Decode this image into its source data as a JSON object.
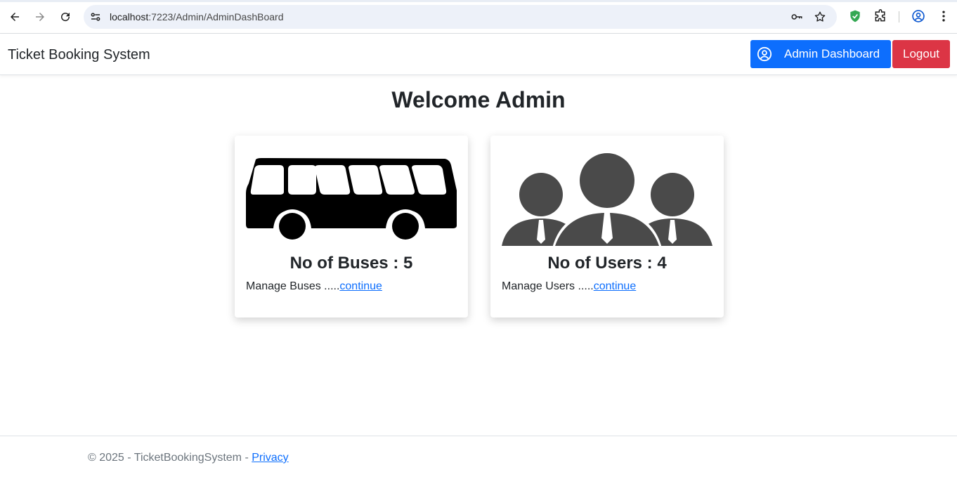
{
  "browser": {
    "url_host": "localhost",
    "url_path": ":7223/Admin/AdminDashBoard"
  },
  "navbar": {
    "brand": "Ticket Booking System",
    "admin_dashboard_label": "Admin Dashboard",
    "logout_label": "Logout",
    "admin_color": "#0d6efd",
    "logout_color": "#dc3545"
  },
  "main": {
    "welcome": "Welcome Admin",
    "cards": [
      {
        "icon": "bus-icon",
        "count_text": "No of Buses : 5",
        "manage_text": "Manage Buses .....",
        "link_text": "continue"
      },
      {
        "icon": "users-icon",
        "count_text": "No of Users : 4",
        "manage_text": "Manage Users .....",
        "link_text": "continue"
      }
    ]
  },
  "footer": {
    "text": "© 2025 - TicketBookingSystem - ",
    "privacy_label": "Privacy"
  }
}
